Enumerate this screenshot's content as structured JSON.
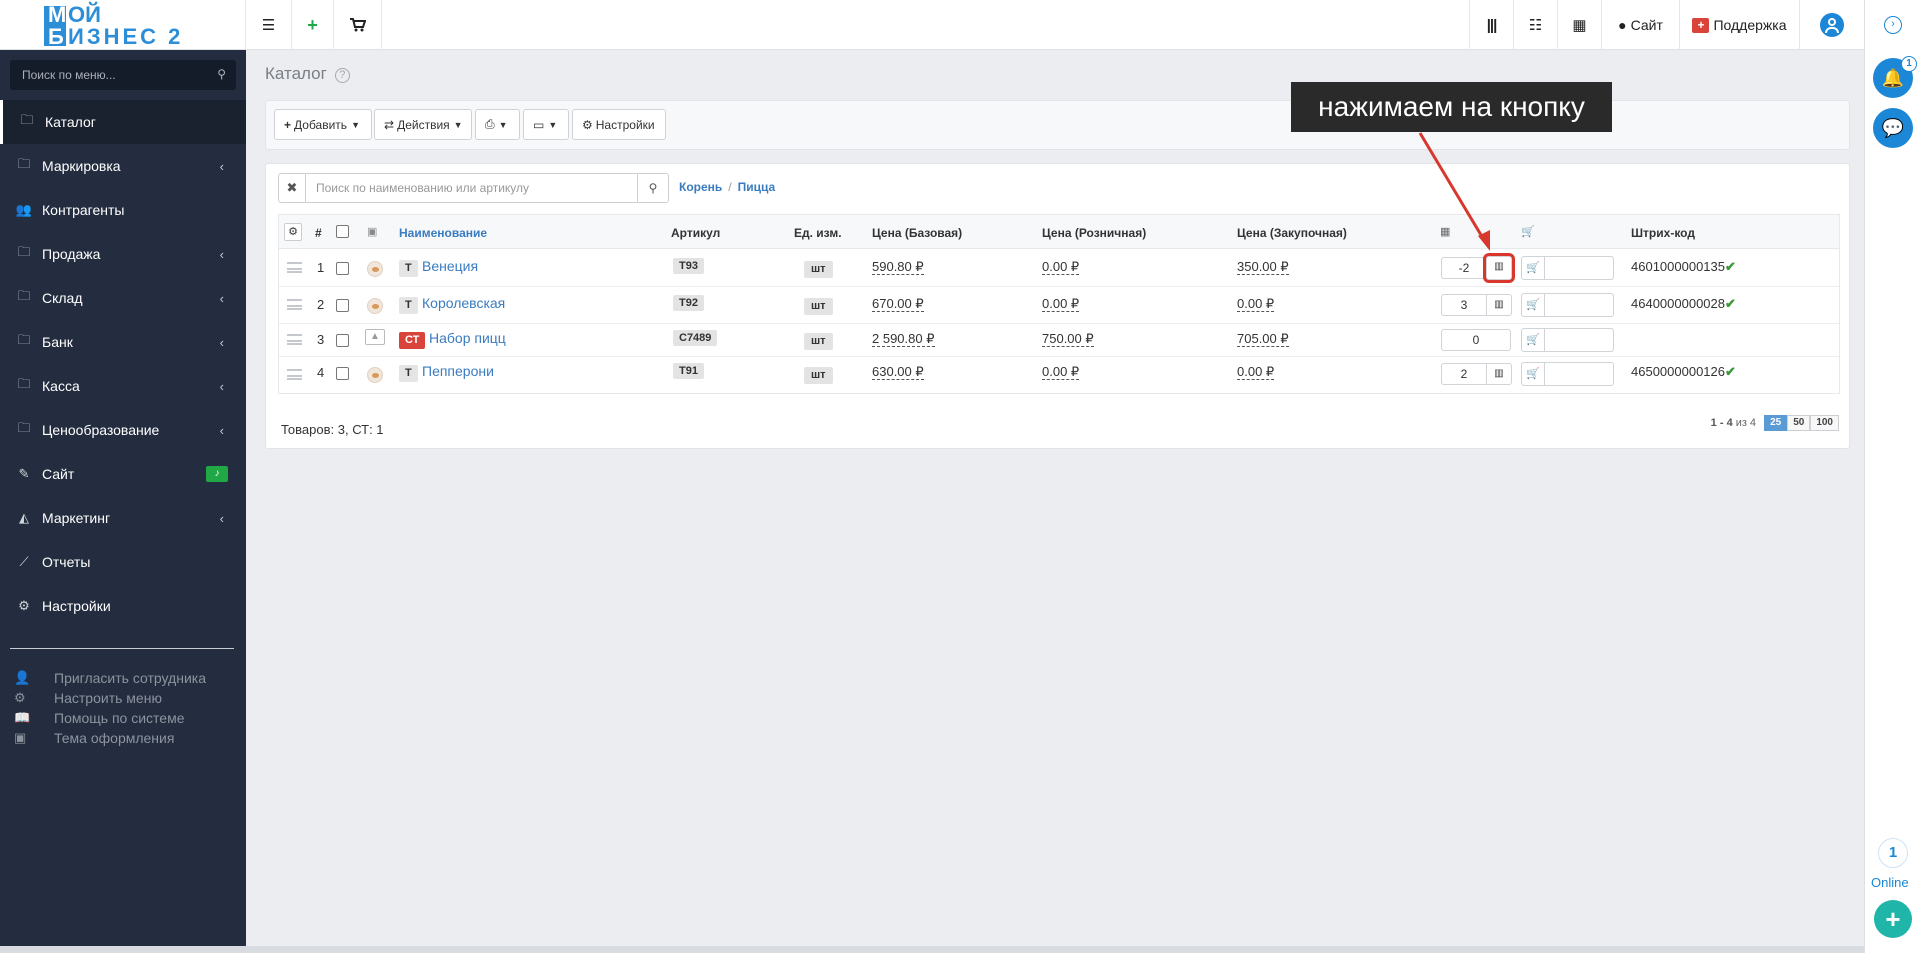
{
  "header": {
    "logo_text": "МОЙ БИЗНЕС 2",
    "menu_icon": "hamburger-icon",
    "add_icon": "plus-icon",
    "cart_icon": "cart-icon",
    "site_label": "Сайт",
    "support_label": "Поддержка"
  },
  "sidebar": {
    "search_placeholder": "Поиск по меню...",
    "items": [
      {
        "label": "Каталог",
        "icon": "folder-icon"
      },
      {
        "label": "Маркировка",
        "icon": "folder-icon"
      },
      {
        "label": "Контрагенты",
        "icon": "users-icon"
      },
      {
        "label": "Продажа",
        "icon": "folder-icon"
      },
      {
        "label": "Склад",
        "icon": "folder-icon"
      },
      {
        "label": "Банк",
        "icon": "folder-icon"
      },
      {
        "label": "Касса",
        "icon": "folder-icon"
      },
      {
        "label": "Ценообразование",
        "icon": "folder-icon"
      },
      {
        "label": "Сайт",
        "icon": "wand-icon"
      },
      {
        "label": "Маркетинг",
        "icon": "area-chart-icon"
      },
      {
        "label": "Отчеты",
        "icon": "line-chart-icon"
      },
      {
        "label": "Настройки",
        "icon": "gear-icon"
      }
    ],
    "links": [
      {
        "label": "Пригласить сотрудника"
      },
      {
        "label": "Настроить меню"
      },
      {
        "label": "Помощь по системе"
      },
      {
        "label": "Тема оформления"
      }
    ]
  },
  "page": {
    "title": "Каталог",
    "toolbar": {
      "add": "Добавить",
      "actions": "Действия",
      "settings": "Настройки"
    },
    "search_placeholder": "Поиск по наименованию или артикулу",
    "breadcrumb": [
      "Корень",
      "Пицца"
    ],
    "columns": {
      "num": "#",
      "name": "Наименование",
      "article": "Артикул",
      "unit": "Ед. изм.",
      "price_base": "Цена (Базовая)",
      "price_retail": "Цена (Розничная)",
      "price_purchase": "Цена (Закупочная)",
      "barcode": "Штрих-код"
    },
    "rows": [
      {
        "n": "1",
        "type": "Т",
        "name": "Венеция",
        "article": "Т93",
        "unit": "шт",
        "base": "590.80 ₽",
        "retail": "0.00 ₽",
        "purchase": "350.00 ₽",
        "qty": "-2",
        "barcode": "4601000000135"
      },
      {
        "n": "2",
        "type": "Т",
        "name": "Королевская",
        "article": "Т92",
        "unit": "шт",
        "base": "670.00 ₽",
        "retail": "0.00 ₽",
        "purchase": "0.00 ₽",
        "qty": "3",
        "barcode": "4640000000028"
      },
      {
        "n": "3",
        "type": "СТ",
        "name": "Набор пицц",
        "article": "С7489",
        "unit": "шт",
        "base": "2 590.80 ₽",
        "retail": "750.00 ₽",
        "purchase": "705.00 ₽",
        "qty": "0",
        "barcode": ""
      },
      {
        "n": "4",
        "type": "Т",
        "name": "Пепперони",
        "article": "Т91",
        "unit": "шт",
        "base": "630.00 ₽",
        "retail": "0.00 ₽",
        "purchase": "0.00 ₽",
        "qty": "2",
        "barcode": "4650000000126"
      }
    ],
    "summary": "Товаров: 3, СТ: 1",
    "pager": {
      "range": "1 - 4",
      "of": "из 4",
      "sizes": [
        "25",
        "50",
        "100"
      ]
    }
  },
  "callout": "нажимаем на кнопку",
  "rail": {
    "notif_count": "1",
    "online_count": "1",
    "online_label": "Online"
  },
  "colors": {
    "sidebar": "#232d3f",
    "accent": "#3a7cc0",
    "highlight": "#d8372e"
  }
}
